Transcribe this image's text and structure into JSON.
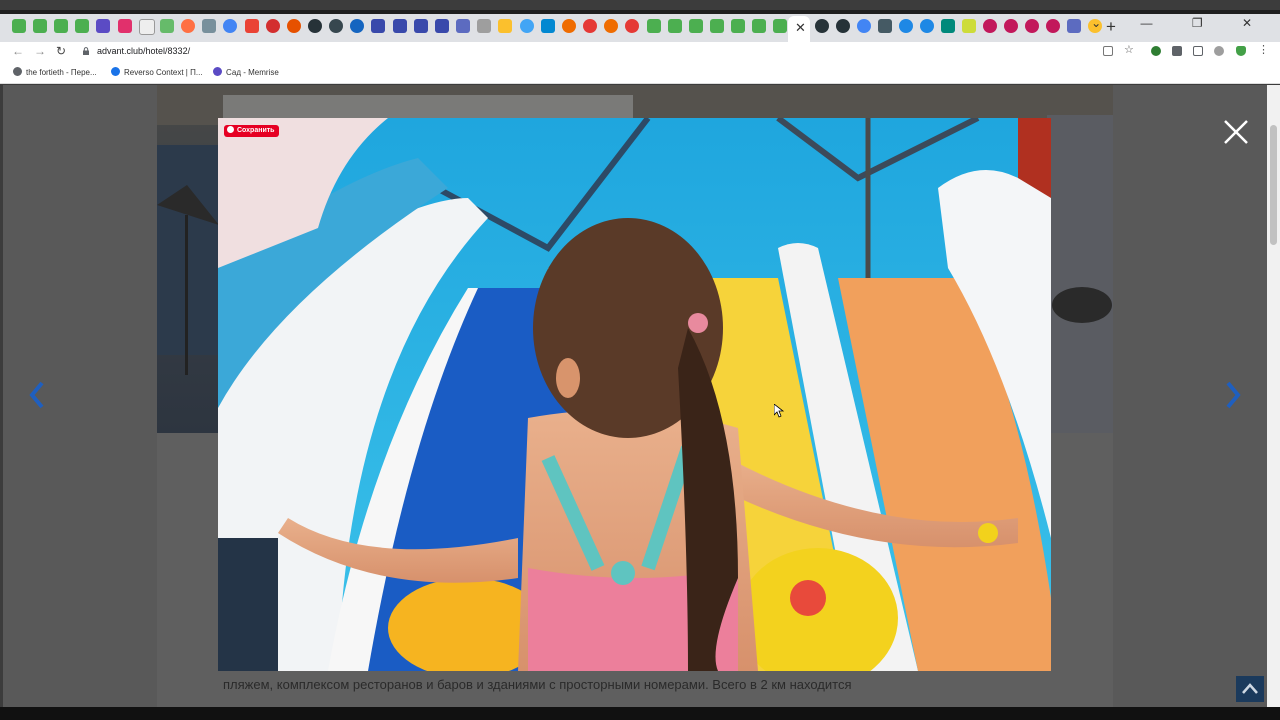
{
  "browser": {
    "url": "advant.club/hotel/8332/",
    "tab_close_glyph": "✕",
    "new_tab_glyph": "+",
    "window_controls": "⌄ — ❐ ✕"
  },
  "bookmarks": [
    {
      "label": "the fortieth - Пере...",
      "color": "#5f6368"
    },
    {
      "label": "Reverso Context | П...",
      "color": "#1a73e8"
    },
    {
      "label": "Сад - Memrise",
      "color": "#5b4bc4"
    }
  ],
  "lightbox": {
    "save_label": "Сохранить",
    "close_icon": "close-icon",
    "prev_icon": "chevron-left-icon",
    "next_icon": "chevron-right-icon"
  },
  "page": {
    "body_text": "пляжем, комплексом ресторанов и баров и зданиями с просторными номерами. Всего в 2 км находится"
  },
  "colors": {
    "accent_arrow": "#1f5fbf",
    "pin_red": "#e60023",
    "pool_blue": "#22aee0"
  }
}
